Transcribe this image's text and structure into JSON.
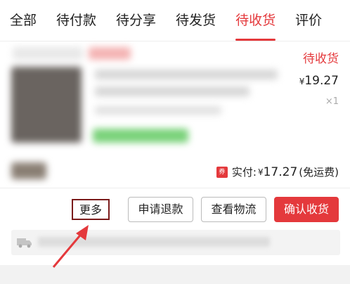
{
  "tabs": [
    {
      "label": "全部",
      "active": false
    },
    {
      "label": "待付款",
      "active": false
    },
    {
      "label": "待分享",
      "active": false
    },
    {
      "label": "待发货",
      "active": false
    },
    {
      "label": "待收货",
      "active": true
    },
    {
      "label": "评价",
      "active": false
    }
  ],
  "order": {
    "status": "待收货",
    "currency": "¥",
    "price": "19.27",
    "quantity": "×1",
    "coupon_icon": "券",
    "paid_label": "实付:",
    "paid_amount": "17.27",
    "shipping_note": "(免运费)"
  },
  "actions": {
    "more": "更多",
    "refund": "申请退款",
    "track": "查看物流",
    "confirm": "确认收货"
  },
  "colors": {
    "accent": "#e4393c",
    "highlight_box": "#7b1b1b"
  },
  "icons": {
    "truck": "truck-icon",
    "annotation": "arrow-icon"
  }
}
